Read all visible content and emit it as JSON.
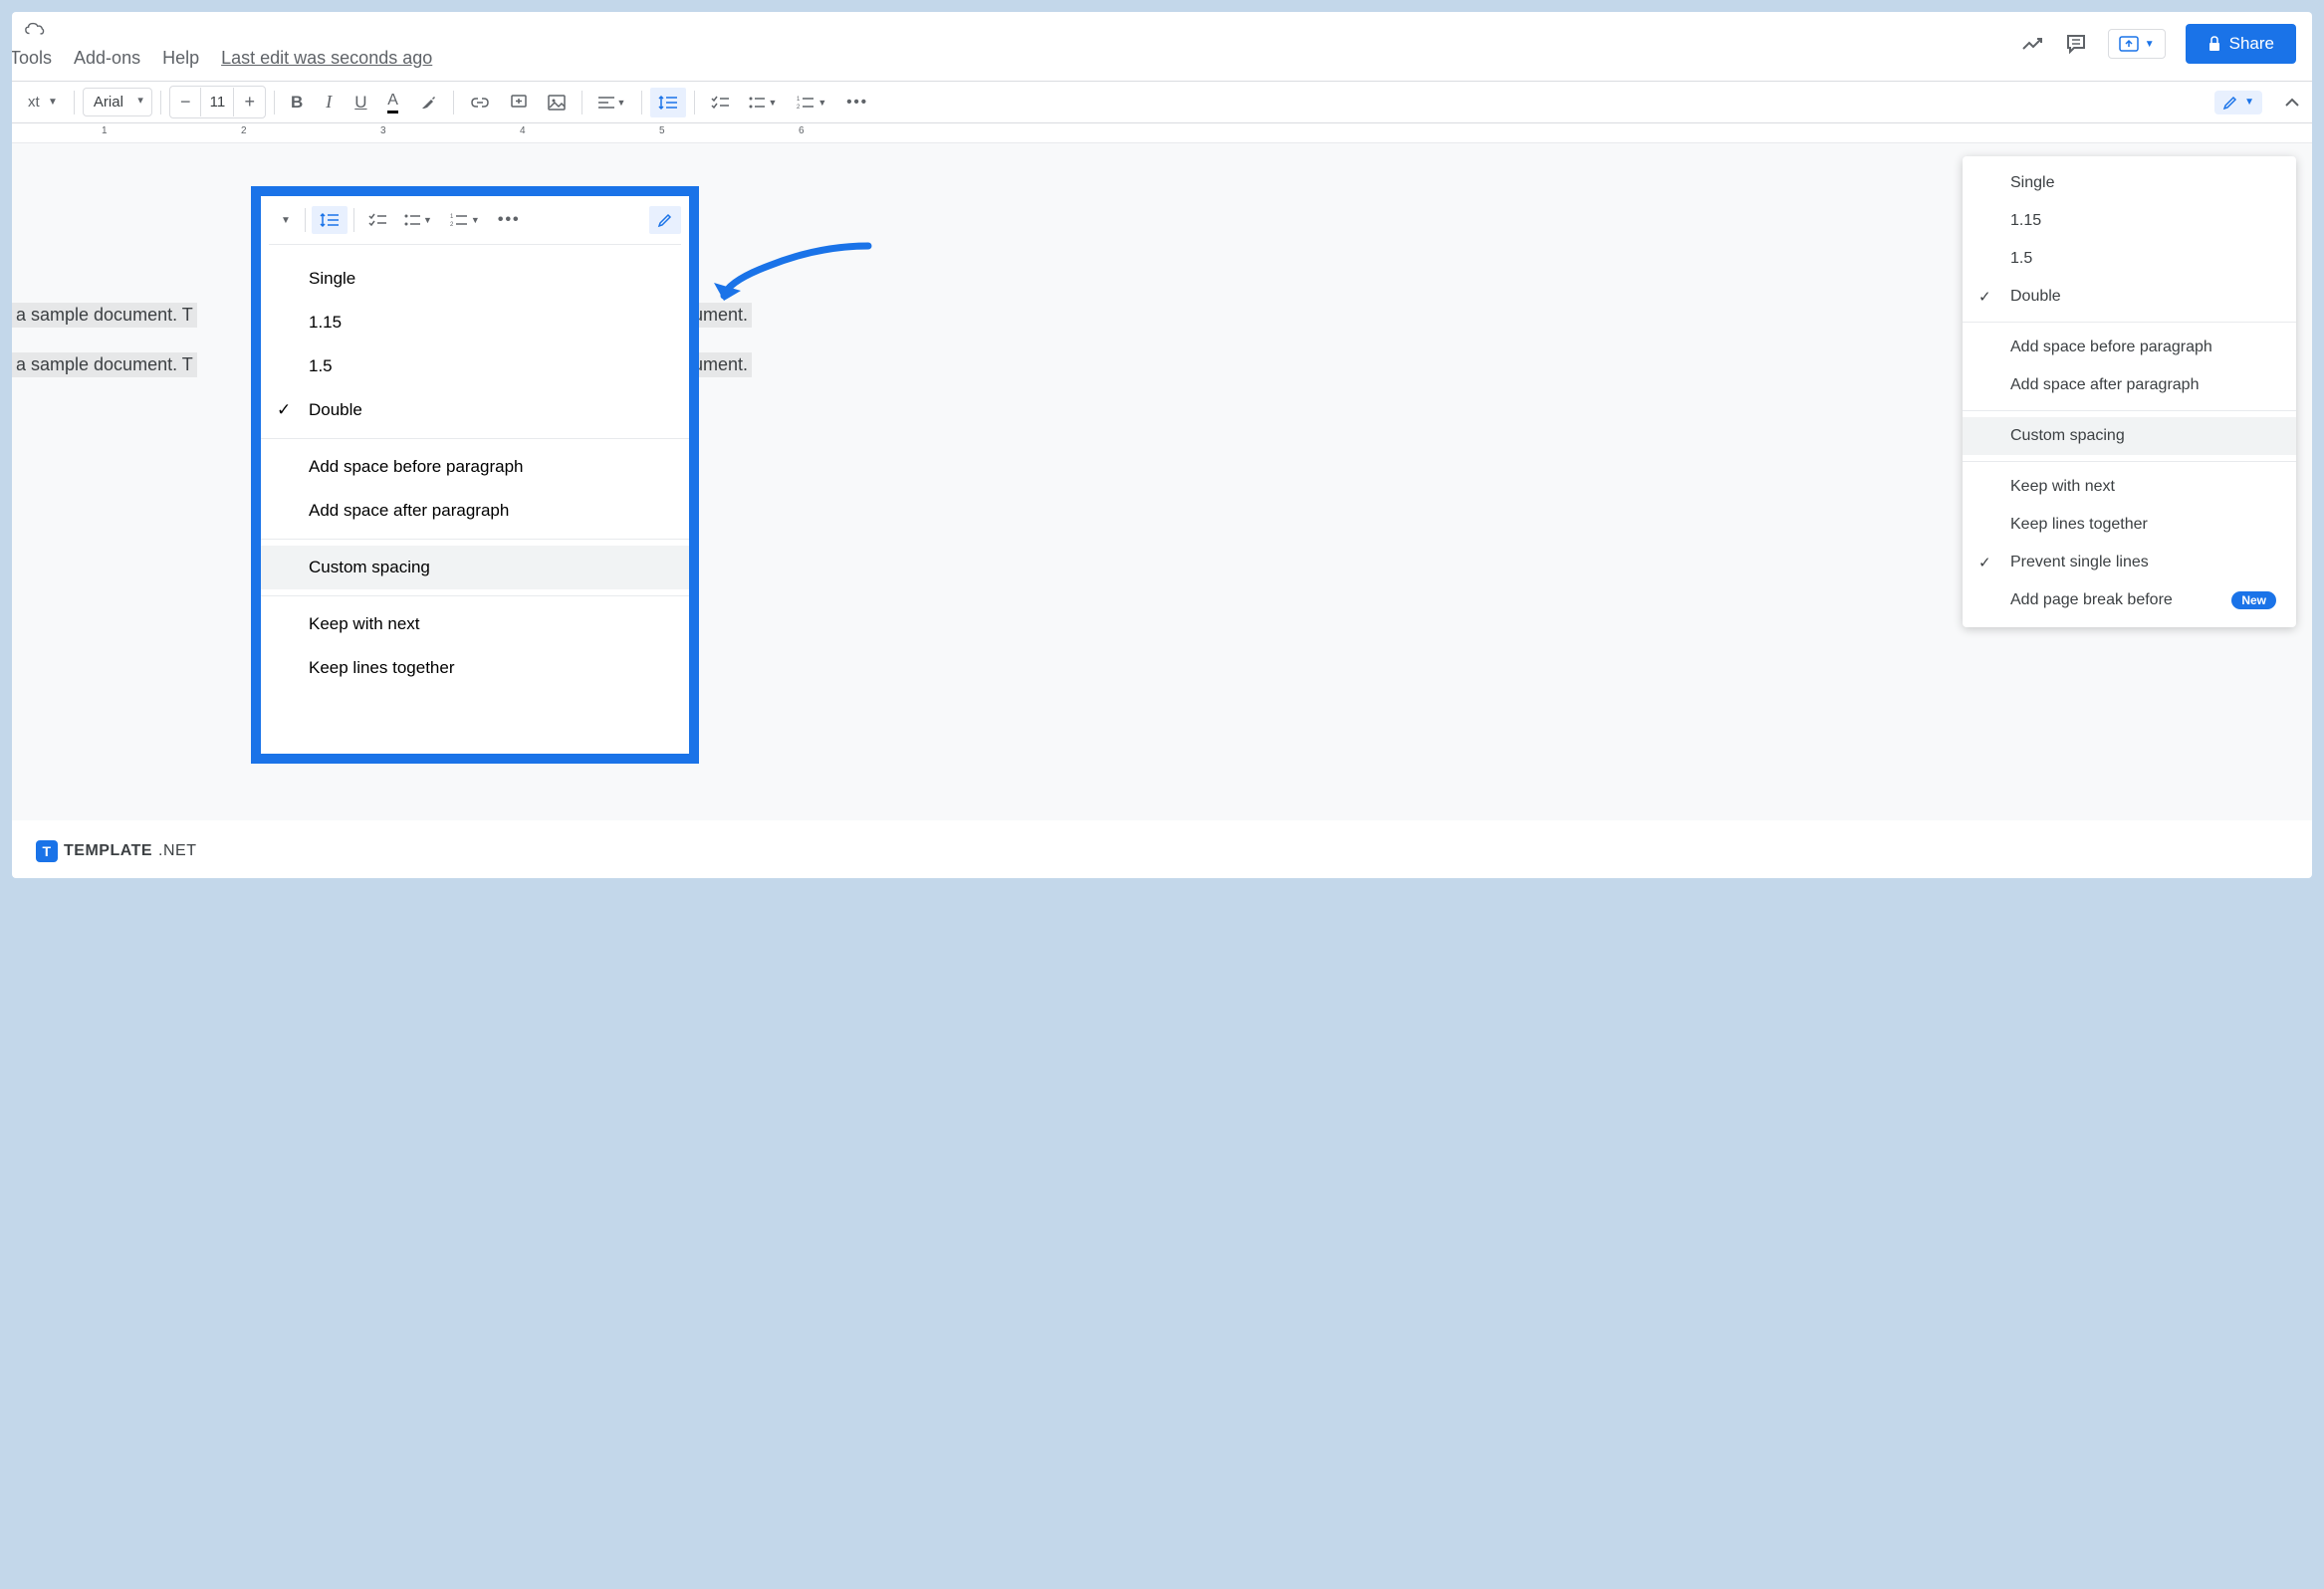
{
  "menubar": {
    "tools": "Tools",
    "addons": "Add-ons",
    "help": "Help",
    "last_edit": "Last edit was seconds ago"
  },
  "share_label": "Share",
  "toolbar": {
    "styles_label": "xt",
    "font": "Arial",
    "font_size": "11"
  },
  "ruler": [
    "1",
    "2",
    "3",
    "4",
    "5",
    "6"
  ],
  "doc": {
    "line1a": " a sample document. T",
    "line1b": "ument.",
    "line2a": " a sample document. T",
    "line2b": "ument."
  },
  "spacing_menu": {
    "single": "Single",
    "v115": "1.15",
    "v15": "1.5",
    "double": "Double",
    "before": "Add space before paragraph",
    "after": "Add space after paragraph",
    "custom": "Custom spacing",
    "keep_next": "Keep with next",
    "keep_lines": "Keep lines together",
    "prevent": "Prevent single lines",
    "page_break": "Add page break before",
    "new_badge": "New"
  },
  "footer": {
    "brand": "TEMPLATE",
    "suffix": ".NET"
  }
}
